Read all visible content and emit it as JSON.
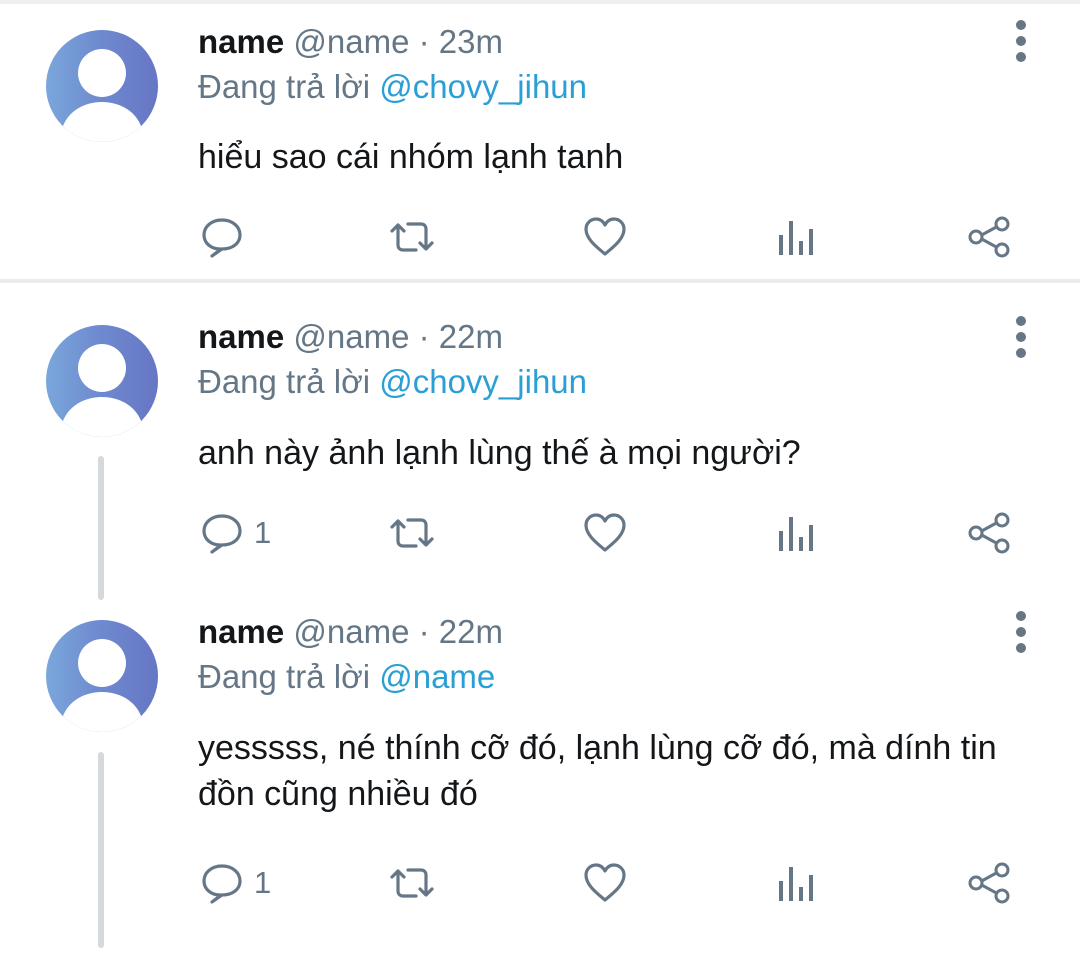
{
  "tweets": [
    {
      "name": "name",
      "handle": "@name",
      "sep": "·",
      "time": "23m",
      "reply_prefix": "Đang trả lời",
      "reply_mention": "@chovy_jihun",
      "text": "hiểu sao cái nhóm lạnh tanh",
      "reply_count": "",
      "icons": [
        "more-vertical-icon",
        "comment-icon",
        "retweet-icon",
        "heart-icon",
        "analytics-icon",
        "share-icon"
      ]
    },
    {
      "name": "name",
      "handle": "@name",
      "sep": "·",
      "time": "22m",
      "reply_prefix": "Đang trả lời",
      "reply_mention": "@chovy_jihun",
      "text": "anh này ảnh lạnh lùng thế à mọi người?",
      "reply_count": "1",
      "icons": [
        "more-vertical-icon",
        "comment-icon",
        "retweet-icon",
        "heart-icon",
        "analytics-icon",
        "share-icon"
      ]
    },
    {
      "name": "name",
      "handle": "@name",
      "sep": "·",
      "time": "22m",
      "reply_prefix": "Đang trả lời",
      "reply_mention": "@name",
      "text": "yesssss, né thính cỡ đó, lạnh lùng cỡ đó, mà dính tin đồn cũng nhiều đó",
      "reply_count": "1",
      "icons": [
        "more-vertical-icon",
        "comment-icon",
        "retweet-icon",
        "heart-icon",
        "analytics-icon",
        "share-icon"
      ]
    }
  ],
  "colors": {
    "text": "#14171a",
    "secondary": "#657786",
    "mention": "#2a9fd6",
    "avatar_left": "#7aa7dc",
    "avatar_right": "#6676c4"
  }
}
